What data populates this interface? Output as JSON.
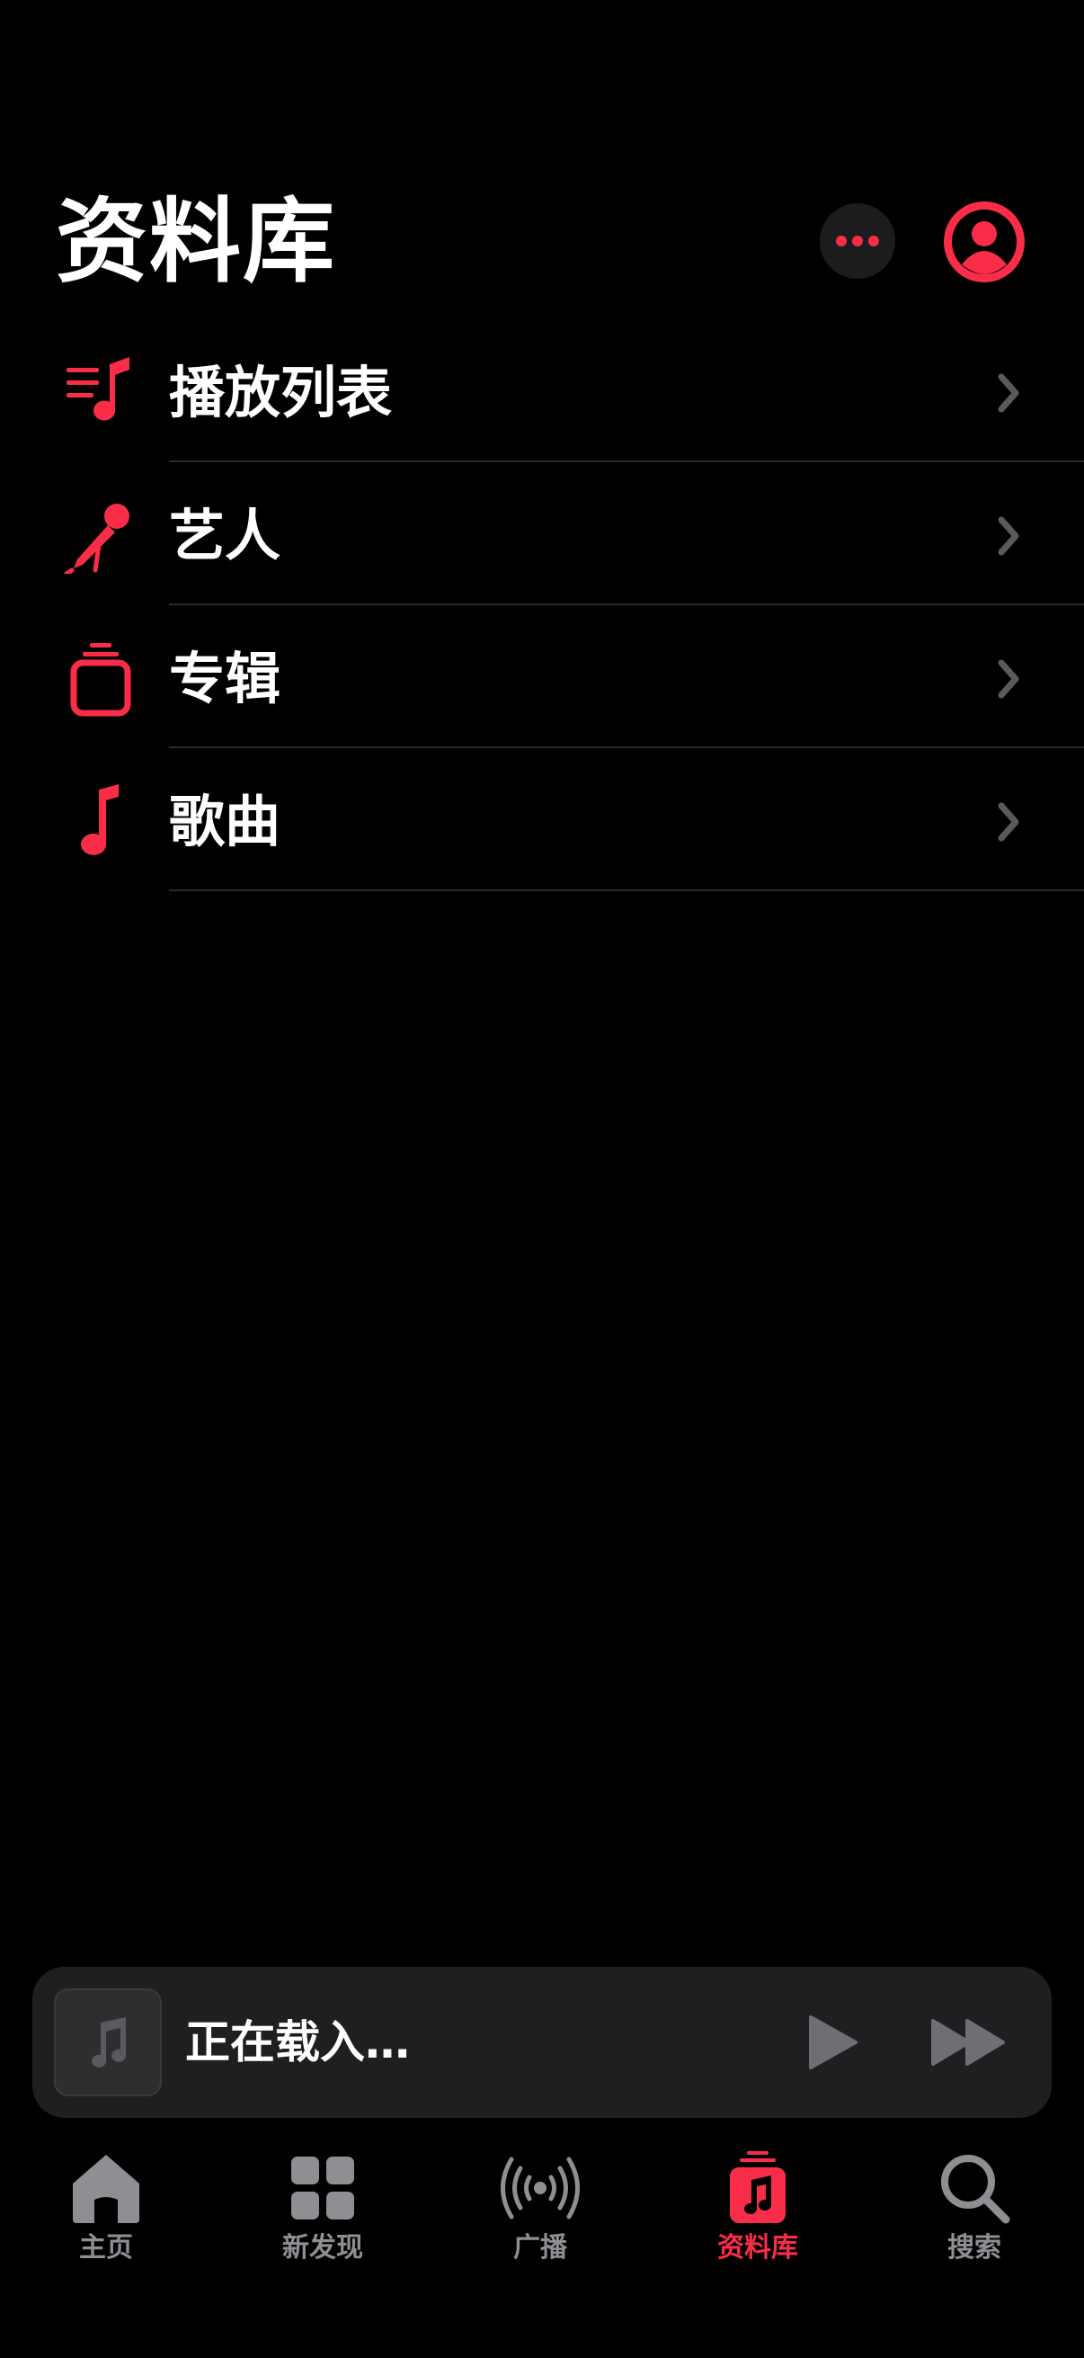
{
  "header": {
    "title": "资料库",
    "more_icon": "ellipsis-icon",
    "account_icon": "account-circle-icon"
  },
  "library": {
    "items": [
      {
        "label": "播放列表",
        "icon": "playlist-icon"
      },
      {
        "label": "艺人",
        "icon": "microphone-icon"
      },
      {
        "label": "专辑",
        "icon": "album-stack-icon"
      },
      {
        "label": "歌曲",
        "icon": "music-note-icon"
      }
    ]
  },
  "mini_player": {
    "title": "正在载入…",
    "play_icon": "play-icon",
    "next_icon": "fast-forward-icon"
  },
  "tabbar": {
    "tabs": [
      {
        "label": "主页",
        "icon": "home-icon"
      },
      {
        "label": "新发现",
        "icon": "grid-icon"
      },
      {
        "label": "广播",
        "icon": "radio-broadcast-icon"
      },
      {
        "label": "资料库",
        "icon": "library-icon",
        "active": true
      },
      {
        "label": "搜索",
        "icon": "search-icon"
      }
    ]
  },
  "colors": {
    "accent": "#fa2d48",
    "background": "#000000",
    "inactive": "#8e8e93"
  }
}
